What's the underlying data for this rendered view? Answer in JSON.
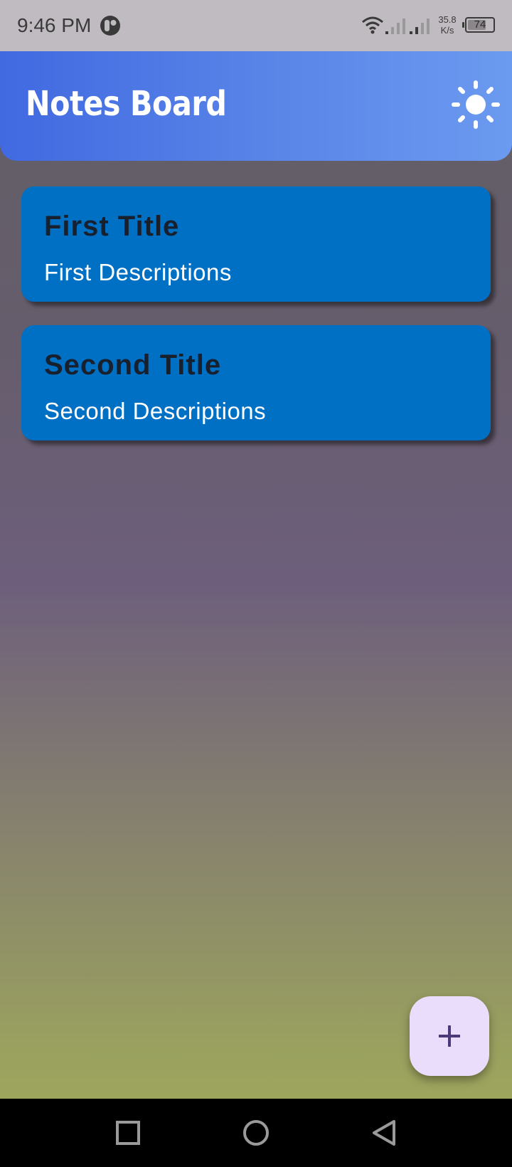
{
  "status_bar": {
    "time": "9:46 PM",
    "net_speed_value": "35.8",
    "net_speed_unit": "K/s",
    "battery_level": "74",
    "battery_fraction": 0.74,
    "icons": [
      "app-notification-icon",
      "wifi-icon",
      "signal-icon",
      "signal-icon",
      "battery-icon"
    ]
  },
  "header": {
    "title": "Notes Board",
    "theme_icon": "sun-icon",
    "background_colors": [
      "#4169e1",
      "#6b9af0"
    ]
  },
  "notes": [
    {
      "title": "First Title",
      "description": "First Descriptions"
    },
    {
      "title": "Second Title",
      "description": "Second Descriptions"
    }
  ],
  "note_card_color": "#0070c5",
  "fab": {
    "icon": "plus-icon",
    "background": "#eadcfb",
    "icon_color": "#4a3a7a"
  },
  "nav_bar": {
    "icons": [
      "recents-square-icon",
      "home-circle-icon",
      "back-triangle-icon"
    ]
  }
}
